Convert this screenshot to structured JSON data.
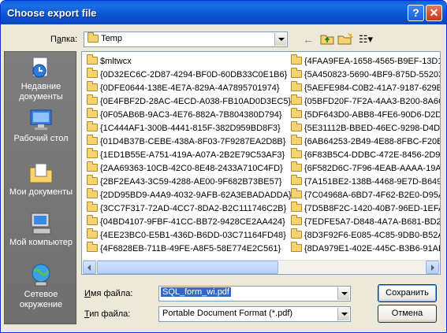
{
  "window": {
    "title": "Choose export file"
  },
  "titlebar": {
    "help_glyph": "?",
    "close_glyph": "✕"
  },
  "lookin": {
    "label_prefix": "П",
    "label_underlined": "а",
    "label_suffix": "пка:",
    "value": "Temp"
  },
  "toolbar": {
    "back_icon": "back-arrow-icon",
    "up_icon": "up-folder-icon",
    "new_folder_icon": "new-folder-icon",
    "view_menu_icon": "view-menu-icon",
    "back_glyph": "←",
    "view_glyph": "☷▾"
  },
  "places": [
    {
      "label": "Недавние документы",
      "icon": "recent-documents-icon"
    },
    {
      "label": "Рабочий стол",
      "icon": "desktop-icon"
    },
    {
      "label": "Мои документы",
      "icon": "my-documents-icon"
    },
    {
      "label": "Мой компьютер",
      "icon": "my-computer-icon"
    },
    {
      "label": "Сетевое окружение",
      "icon": "network-places-icon"
    }
  ],
  "files_col1": [
    "$mltwcx",
    "{0D32EC6C-2D87-4294-BF0D-60DB33C0E1B6}",
    "{0DFE0644-138E-4E7A-829A-4A7895701974}",
    "{0E4FBF2D-28AC-4ECD-A038-FB10AD0D3EC5}",
    "{0F05AB6B-9AC3-4E76-882A-7B804380D794}",
    "{1C444AF1-300B-4441-815F-382D959BD8F3}",
    "{01D4B37B-CEBE-438A-8F03-7F9287EA2D8B}",
    "{1ED1B55E-A751-419A-A07A-2B2E79C53AF3}",
    "{2AA69363-10CB-42C0-8E48-2433A710C4FD}",
    "{2BF2EA43-3C59-4288-AE00-9F682B73BE57}",
    "{2DD95BD9-A4A9-4032-9AFB-62A3EBADADDA}",
    "{3CC7F317-72AD-4CC7-8DA2-B2C111746C2B}",
    "{04BD4107-9FBF-41CC-BB72-9428CE2AA424}",
    "{4EE23BC0-E5B1-436D-B6DD-03C71164FD48}",
    "{4F6828EB-711B-49FE-A8F5-58E774E2C561}"
  ],
  "files_col2": [
    "{4FAA9FEA-1658-4565-B9EF-13D1",
    "{5A450823-5690-4BF9-875D-55203",
    "{5AEFE984-C0B2-41A7-9187-629BI",
    "{05BFD20F-7F2A-4AA3-B200-8A6C",
    "{5DF643D0-ABB8-4FE6-90D6-D2DF",
    "{5E31112B-BBED-46EC-9298-D4D2",
    "{6AB64253-2B49-4E88-8FBC-F20B",
    "{6F83B5C4-DDBC-472E-8456-2D99",
    "{6F582D6C-7F96-4EAB-AAAA-19A2",
    "{7A151BE2-138B-4468-9E7D-B649F",
    "{7C04968A-6BD7-4F62-B2E0-D95A",
    "{7D5B8F2C-1420-40B7-96ED-1EFA",
    "{7EDFE5A7-D848-4A7A-B681-BD22",
    "{8D3F92F6-E085-4C85-9DB0-B52A",
    "{8DA979E1-402E-445C-B3B6-91AE"
  ],
  "filename": {
    "label_prefix": "",
    "label_underlined": "И",
    "label_suffix": "мя файла:",
    "value": "SQL_form_wi.pdf"
  },
  "filetype": {
    "label_prefix": "",
    "label_underlined": "Т",
    "label_suffix": "ип файла:",
    "value": "Portable Document Format (*.pdf)"
  },
  "buttons": {
    "save": "Сохранить",
    "cancel": "Отмена"
  }
}
